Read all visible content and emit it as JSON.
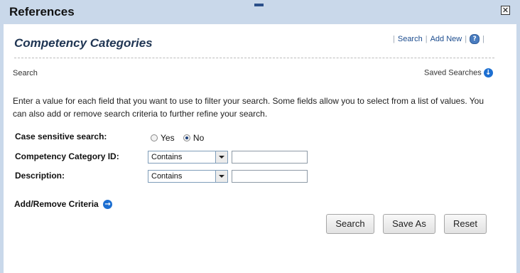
{
  "window": {
    "title": "References",
    "close_glyph": "✕"
  },
  "page": {
    "heading": "Competency Categories",
    "links": {
      "search": "Search",
      "add_new": "Add New",
      "help_glyph": "?"
    },
    "sub_label": "Search",
    "saved_searches": "Saved Searches",
    "instructions": "Enter a value for each field that you want to use to filter your search. Some fields allow you to select from a list of values. You can also add or remove search criteria to further refine your search."
  },
  "form": {
    "case_sensitive": {
      "label": "Case sensitive search:",
      "yes": "Yes",
      "no": "No",
      "selected": "No"
    },
    "id_field": {
      "label": "Competency Category ID:",
      "operator": "Contains",
      "value": ""
    },
    "description": {
      "label": "Description:",
      "operator": "Contains",
      "value": ""
    },
    "add_remove": "Add/Remove Criteria"
  },
  "buttons": {
    "search": "Search",
    "save_as": "Save As",
    "reset": "Reset"
  },
  "icons": {
    "saved_searches": "arrow-down-circle-icon",
    "add_remove": "arrow-right-circle-icon",
    "help": "help-icon",
    "close": "close-icon"
  },
  "colors": {
    "accent": "#1d6fd1",
    "titlebar": "#c9d8ea",
    "heading": "#1f3553"
  }
}
